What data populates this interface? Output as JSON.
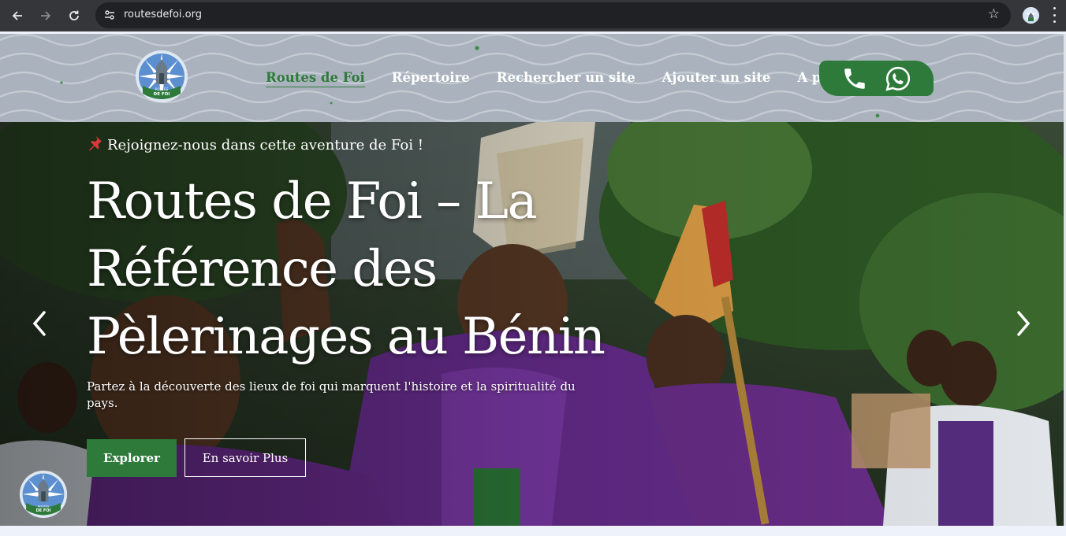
{
  "browser": {
    "url": "routesdefoi.org",
    "back_icon": "arrow-left-icon",
    "forward_icon": "arrow-right-icon",
    "reload_icon": "reload-icon",
    "site_info_icon": "tune-icon",
    "bookmark_icon": "star-icon",
    "menu_icon": "kebab-menu-icon"
  },
  "header": {
    "nav": [
      {
        "label": "Routes de Foi",
        "active": true
      },
      {
        "label": "Répertoire"
      },
      {
        "label": "Rechercher un site"
      },
      {
        "label": "Ajouter un site"
      },
      {
        "label": "A propos",
        "dropdown": true
      }
    ],
    "contact_icons": [
      "phone-icon",
      "whatsapp-icon"
    ],
    "colors": {
      "brand_green": "#2d7a3a",
      "header_bg": "#aab3bd"
    }
  },
  "hero": {
    "pin_text": "Rejoignez-nous dans cette aventure de Foi !",
    "title": "Routes de Foi – La Référence des Pèlerinages au Bénin",
    "subtitle": "Partez à la découverte des lieux de foi qui marquent l'histoire et la spiritualité du pays.",
    "primary_button": "Explorer",
    "secondary_button": "En savoir Plus",
    "prev_icon": "chevron-left-icon",
    "next_icon": "chevron-right-icon"
  }
}
